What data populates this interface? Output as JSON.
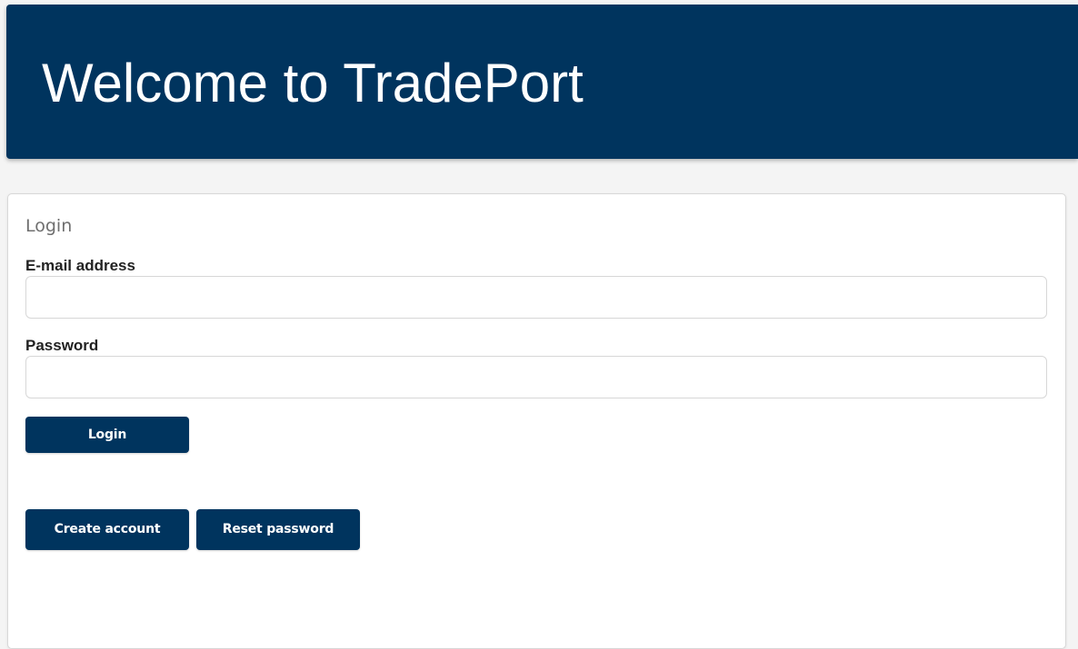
{
  "header": {
    "title": "Welcome to TradePort"
  },
  "login_card": {
    "title": "Login",
    "email": {
      "label": "E-mail address",
      "value": "",
      "placeholder": ""
    },
    "password": {
      "label": "Password",
      "value": "",
      "placeholder": ""
    },
    "login_button_label": "Login",
    "create_account_button_label": "Create account",
    "reset_password_button_label": "Reset password"
  },
  "colors": {
    "brand_primary": "#00345e",
    "page_background": "#f4f4f4",
    "card_background": "#ffffff",
    "input_border": "#d7d7d7",
    "card_title": "#6f6f6f",
    "field_label": "#222222"
  }
}
